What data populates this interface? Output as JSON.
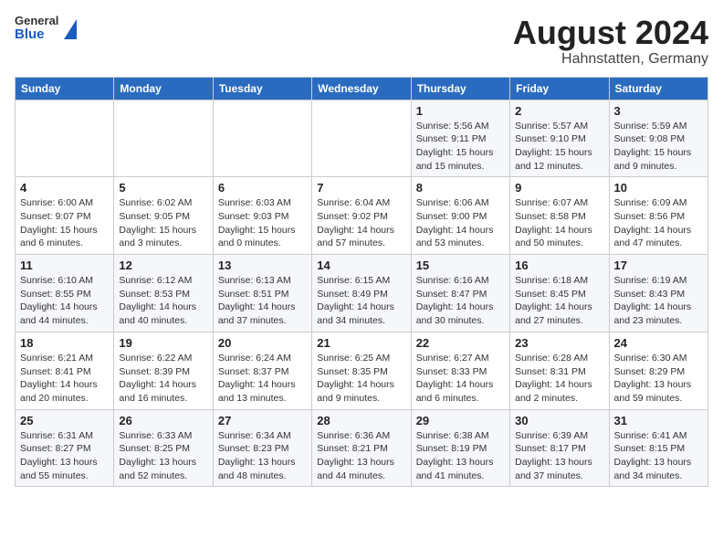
{
  "header": {
    "logo": {
      "general": "General",
      "blue": "Blue"
    },
    "month_year": "August 2024",
    "location": "Hahnstatten, Germany"
  },
  "weekdays": [
    "Sunday",
    "Monday",
    "Tuesday",
    "Wednesday",
    "Thursday",
    "Friday",
    "Saturday"
  ],
  "weeks": [
    [
      {
        "day": "",
        "info": ""
      },
      {
        "day": "",
        "info": ""
      },
      {
        "day": "",
        "info": ""
      },
      {
        "day": "",
        "info": ""
      },
      {
        "day": "1",
        "info": "Sunrise: 5:56 AM\nSunset: 9:11 PM\nDaylight: 15 hours and 15 minutes."
      },
      {
        "day": "2",
        "info": "Sunrise: 5:57 AM\nSunset: 9:10 PM\nDaylight: 15 hours and 12 minutes."
      },
      {
        "day": "3",
        "info": "Sunrise: 5:59 AM\nSunset: 9:08 PM\nDaylight: 15 hours and 9 minutes."
      }
    ],
    [
      {
        "day": "4",
        "info": "Sunrise: 6:00 AM\nSunset: 9:07 PM\nDaylight: 15 hours and 6 minutes."
      },
      {
        "day": "5",
        "info": "Sunrise: 6:02 AM\nSunset: 9:05 PM\nDaylight: 15 hours and 3 minutes."
      },
      {
        "day": "6",
        "info": "Sunrise: 6:03 AM\nSunset: 9:03 PM\nDaylight: 15 hours and 0 minutes."
      },
      {
        "day": "7",
        "info": "Sunrise: 6:04 AM\nSunset: 9:02 PM\nDaylight: 14 hours and 57 minutes."
      },
      {
        "day": "8",
        "info": "Sunrise: 6:06 AM\nSunset: 9:00 PM\nDaylight: 14 hours and 53 minutes."
      },
      {
        "day": "9",
        "info": "Sunrise: 6:07 AM\nSunset: 8:58 PM\nDaylight: 14 hours and 50 minutes."
      },
      {
        "day": "10",
        "info": "Sunrise: 6:09 AM\nSunset: 8:56 PM\nDaylight: 14 hours and 47 minutes."
      }
    ],
    [
      {
        "day": "11",
        "info": "Sunrise: 6:10 AM\nSunset: 8:55 PM\nDaylight: 14 hours and 44 minutes."
      },
      {
        "day": "12",
        "info": "Sunrise: 6:12 AM\nSunset: 8:53 PM\nDaylight: 14 hours and 40 minutes."
      },
      {
        "day": "13",
        "info": "Sunrise: 6:13 AM\nSunset: 8:51 PM\nDaylight: 14 hours and 37 minutes."
      },
      {
        "day": "14",
        "info": "Sunrise: 6:15 AM\nSunset: 8:49 PM\nDaylight: 14 hours and 34 minutes."
      },
      {
        "day": "15",
        "info": "Sunrise: 6:16 AM\nSunset: 8:47 PM\nDaylight: 14 hours and 30 minutes."
      },
      {
        "day": "16",
        "info": "Sunrise: 6:18 AM\nSunset: 8:45 PM\nDaylight: 14 hours and 27 minutes."
      },
      {
        "day": "17",
        "info": "Sunrise: 6:19 AM\nSunset: 8:43 PM\nDaylight: 14 hours and 23 minutes."
      }
    ],
    [
      {
        "day": "18",
        "info": "Sunrise: 6:21 AM\nSunset: 8:41 PM\nDaylight: 14 hours and 20 minutes."
      },
      {
        "day": "19",
        "info": "Sunrise: 6:22 AM\nSunset: 8:39 PM\nDaylight: 14 hours and 16 minutes."
      },
      {
        "day": "20",
        "info": "Sunrise: 6:24 AM\nSunset: 8:37 PM\nDaylight: 14 hours and 13 minutes."
      },
      {
        "day": "21",
        "info": "Sunrise: 6:25 AM\nSunset: 8:35 PM\nDaylight: 14 hours and 9 minutes."
      },
      {
        "day": "22",
        "info": "Sunrise: 6:27 AM\nSunset: 8:33 PM\nDaylight: 14 hours and 6 minutes."
      },
      {
        "day": "23",
        "info": "Sunrise: 6:28 AM\nSunset: 8:31 PM\nDaylight: 14 hours and 2 minutes."
      },
      {
        "day": "24",
        "info": "Sunrise: 6:30 AM\nSunset: 8:29 PM\nDaylight: 13 hours and 59 minutes."
      }
    ],
    [
      {
        "day": "25",
        "info": "Sunrise: 6:31 AM\nSunset: 8:27 PM\nDaylight: 13 hours and 55 minutes."
      },
      {
        "day": "26",
        "info": "Sunrise: 6:33 AM\nSunset: 8:25 PM\nDaylight: 13 hours and 52 minutes."
      },
      {
        "day": "27",
        "info": "Sunrise: 6:34 AM\nSunset: 8:23 PM\nDaylight: 13 hours and 48 minutes."
      },
      {
        "day": "28",
        "info": "Sunrise: 6:36 AM\nSunset: 8:21 PM\nDaylight: 13 hours and 44 minutes."
      },
      {
        "day": "29",
        "info": "Sunrise: 6:38 AM\nSunset: 8:19 PM\nDaylight: 13 hours and 41 minutes."
      },
      {
        "day": "30",
        "info": "Sunrise: 6:39 AM\nSunset: 8:17 PM\nDaylight: 13 hours and 37 minutes."
      },
      {
        "day": "31",
        "info": "Sunrise: 6:41 AM\nSunset: 8:15 PM\nDaylight: 13 hours and 34 minutes."
      }
    ]
  ]
}
